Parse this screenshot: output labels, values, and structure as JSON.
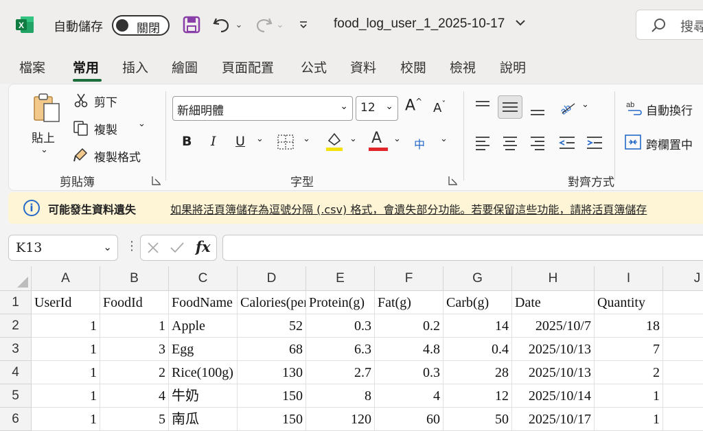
{
  "titlebar": {
    "autosave_label": "自動儲存",
    "autosave_state": "關閉",
    "filename": "food_log_user_1_2025-10-17",
    "search_placeholder": "搜尋",
    "app_icon_letter": "X"
  },
  "tabs": [
    {
      "label": "檔案"
    },
    {
      "label": "常用",
      "active": true
    },
    {
      "label": "插入"
    },
    {
      "label": "繪圖"
    },
    {
      "label": "頁面配置"
    },
    {
      "label": "公式"
    },
    {
      "label": "資料"
    },
    {
      "label": "校閱"
    },
    {
      "label": "檢視"
    },
    {
      "label": "說明"
    }
  ],
  "ribbon": {
    "clipboard": {
      "paste": "貼上",
      "cut": "剪下",
      "copy": "複製",
      "format_painter": "複製格式",
      "group_label": "剪貼簿"
    },
    "font": {
      "font_name": "新細明體",
      "font_size": "12",
      "bold": "B",
      "italic": "I",
      "underline": "U",
      "font_color_letter": "A",
      "grow_letter": "A",
      "shrink_letter": "A",
      "phonetic": "中",
      "group_label": "字型",
      "highlight_color": "#f5e10a",
      "font_color": "#e0252b"
    },
    "alignment": {
      "wrap_text": "自動換行",
      "merge_center": "跨欄置中",
      "group_label": "對齊方式"
    }
  },
  "infobar": {
    "title": "可能發生資料遺失",
    "message": "如果將活頁簿儲存為逗號分隔 (.csv) 格式，會遺失部分功能。若要保留這些功能，請將活頁簿儲存"
  },
  "formulabar": {
    "name_box": "K13",
    "fx": "fx",
    "formula": ""
  },
  "sheet": {
    "columns": [
      "A",
      "B",
      "C",
      "D",
      "E",
      "F",
      "G",
      "H",
      "I",
      "J"
    ],
    "row_numbers": [
      "1",
      "2",
      "3",
      "4",
      "5",
      "6"
    ],
    "headers": [
      "UserId",
      "FoodId",
      "FoodName",
      "Calories(per)",
      "Protein(g)",
      "Fat(g)",
      "Carb(g)",
      "Date",
      "Quantity"
    ],
    "rows": [
      [
        "1",
        "1",
        "Apple",
        "52",
        "0.3",
        "0.2",
        "14",
        "2025/10/7",
        "18"
      ],
      [
        "1",
        "3",
        "Egg",
        "68",
        "6.3",
        "4.8",
        "0.4",
        "2025/10/13",
        "7"
      ],
      [
        "1",
        "2",
        "Rice(100g)",
        "130",
        "2.7",
        "0.3",
        "28",
        "2025/10/13",
        "2"
      ],
      [
        "1",
        "4",
        "牛奶",
        "150",
        "8",
        "4",
        "12",
        "2025/10/14",
        "1"
      ],
      [
        "1",
        "5",
        "南瓜",
        "150",
        "120",
        "60",
        "50",
        "2025/10/17",
        "1"
      ]
    ]
  },
  "colors": {
    "excel_green": "#1b6e3b",
    "save_purple": "#8a3ea8",
    "info_blue": "#2469c9",
    "infobar_bg": "#fdf5d6"
  }
}
